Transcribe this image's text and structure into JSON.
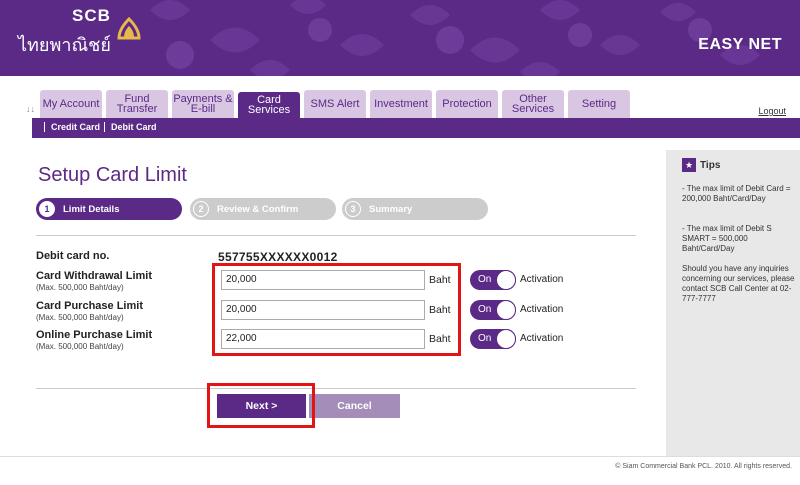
{
  "header": {
    "logo_text": "SCB",
    "logo_thai": "ไทยพาณิชย์",
    "brand_title": "EASY NET",
    "emblem_icon": "scb-lotus-emblem",
    "colors": {
      "primary": "#5a2a86",
      "tab_inactive": "#d9c6e3",
      "highlight": "#e11515"
    }
  },
  "tabs": [
    {
      "label": "My Account"
    },
    {
      "label": "Fund Transfer"
    },
    {
      "label": "Payments & E-bill"
    },
    {
      "label": "Card Services",
      "active": true
    },
    {
      "label": "SMS Alert"
    },
    {
      "label": "Investment"
    },
    {
      "label": "Protection"
    },
    {
      "label": "Other Services"
    },
    {
      "label": "Setting"
    }
  ],
  "tabbar_marker": "↓↓",
  "logout": "Logout",
  "subnav": [
    "Credit Card",
    "Debit Card"
  ],
  "page_title": "Setup Card Limit",
  "steps": [
    {
      "num": "1",
      "label": "Limit Details"
    },
    {
      "num": "2",
      "label": "Review & Confirm"
    },
    {
      "num": "3",
      "label": "Summary"
    }
  ],
  "form": {
    "card_label": "Debit card no.",
    "card_number": "557755XXXXXX0012",
    "rows": [
      {
        "label": "Card Withdrawal Limit",
        "hint": "(Max. 500,000 Baht/day)",
        "value": "20,000",
        "unit": "Baht",
        "toggle": "On",
        "toggle_label": "Activation"
      },
      {
        "label": "Card Purchase Limit",
        "hint": "(Max. 500,000 Baht/day)",
        "value": "20,000",
        "unit": "Baht",
        "toggle": "On",
        "toggle_label": "Activation"
      },
      {
        "label": "Online Purchase Limit",
        "hint": "(Max. 500,000 Baht/day)",
        "value": "22,000",
        "unit": "Baht",
        "toggle": "On",
        "toggle_label": "Activation"
      }
    ]
  },
  "buttons": {
    "next": "Next >",
    "cancel": "Cancel"
  },
  "tips": {
    "title": "Tips",
    "icon": "star-icon",
    "items": [
      "- The max limit of Debit Card = 200,000 Baht/Card/Day",
      "- The max limit of Debit S SMART = 500,000 Baht/Card/Day",
      "Should you have any inquiries concerning our services, please contact SCB Call Center at 02-777-7777"
    ]
  },
  "footer": "© Siam Commercial Bank PCL. 2010. All rights reserved."
}
